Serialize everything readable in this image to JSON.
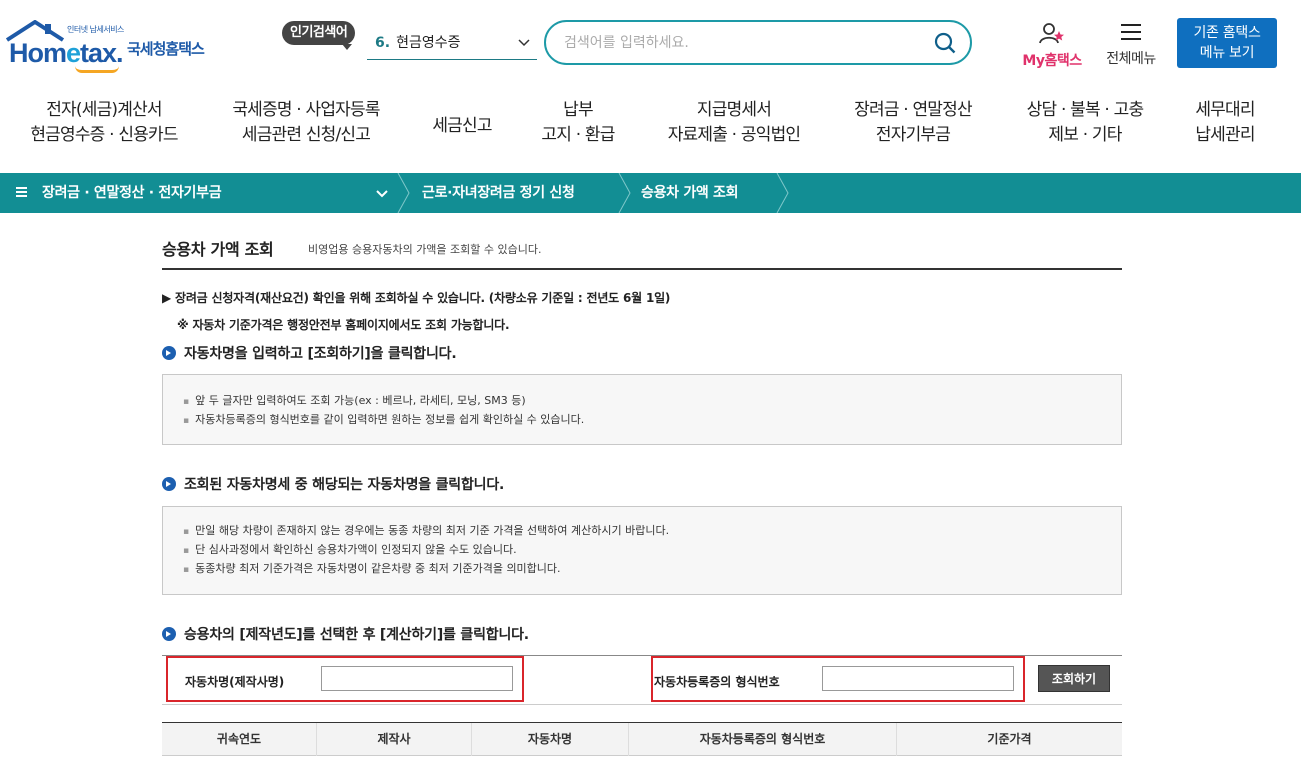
{
  "header": {
    "logo_small": "인터넷 납세서비스",
    "logo_word_pre": "Hom",
    "logo_word_e": "e",
    "logo_word_post": "tax.",
    "logo_kor": "국세청홈택스",
    "popular_label": "인기검색어",
    "popular_num": "6.",
    "popular_value": "현금영수증",
    "search_placeholder": "검색어를 입력하세요.",
    "my_label": "My홈택스",
    "allmenu_label": "전체메뉴",
    "oldhome_line1": "기존 홈택스",
    "oldhome_line2": "메뉴 보기"
  },
  "gnb": [
    {
      "l1": "전자(세금)계산서",
      "l2": "현금영수증 · 신용카드"
    },
    {
      "l1": "국세증명 · 사업자등록",
      "l2": "세금관련 신청/신고"
    },
    {
      "l1": "세금신고",
      "l2": ""
    },
    {
      "l1": "납부",
      "l2": "고지 · 환급"
    },
    {
      "l1": "지급명세서",
      "l2": "자료제출 · 공익법인"
    },
    {
      "l1": "장려금 · 연말정산",
      "l2": "전자기부금"
    },
    {
      "l1": "상담 · 불복 · 고충",
      "l2": "제보 · 기타"
    },
    {
      "l1": "세무대리",
      "l2": "납세관리"
    }
  ],
  "breadcrumb": {
    "level1": "장려금 · 연말정산 · 전자기부금",
    "level2": "근로·자녀장려금 정기 신청",
    "level3": "승용차 가액 조회"
  },
  "page": {
    "title": "승용차 가액 조회",
    "desc": "비영업용 승용자동차의 가액을 조회할 수 있습니다.",
    "notice1": "▶ 장려금 신청자격(재산요건) 확인을 위해 조회하실 수 있습니다. (차량소유 기준일 : 전년도 6월 1일)",
    "notice2": "※ 자동차 기준가격은 행정안전부 홈페이지에서도 조회 가능합니다."
  },
  "steps": {
    "step1": "자동차명을 입력하고 [조회하기]을 클릭합니다.",
    "step1_items": [
      "앞 두 글자만 입력하여도 조회 가능(ex : 베르나, 라세티, 모닝, SM3 등)",
      "자동차등록증의 형식번호를 같이 입력하면 원하는 정보를 쉽게 확인하실 수 있습니다."
    ],
    "step2": "조회된 자동차명세 중 해당되는 자동차명을 클릭합니다.",
    "step2_items": [
      "만일 해당 차량이 존재하지 않는 경우에는 동종 차량의 최저 기준 가격을 선택하여 계산하시기 바랍니다.",
      "단 심사과정에서 확인하신 승용차가액이 인정되지 않을 수도 있습니다.",
      "동종차량 최저 기준가격은 자동차명이 같은차량 중  최저 기준가격을 의미합니다."
    ],
    "step3": "승용차의 [제작년도]를 선택한 후 [계산하기]를 클릭합니다."
  },
  "form": {
    "car_name_label": "자동차명(제작사명)",
    "car_name_value": "",
    "type_no_label": "자동차등록증의 형식번호",
    "type_no_value": "",
    "search_button": "조회하기"
  },
  "table": {
    "columns": [
      "귀속연도",
      "제작사",
      "자동차명",
      "자동차등록증의 형식번호",
      "기준가격"
    ]
  },
  "colors": {
    "teal": "#128e94",
    "blue": "#0f6fbf",
    "highlight_red": "#d9252b"
  }
}
